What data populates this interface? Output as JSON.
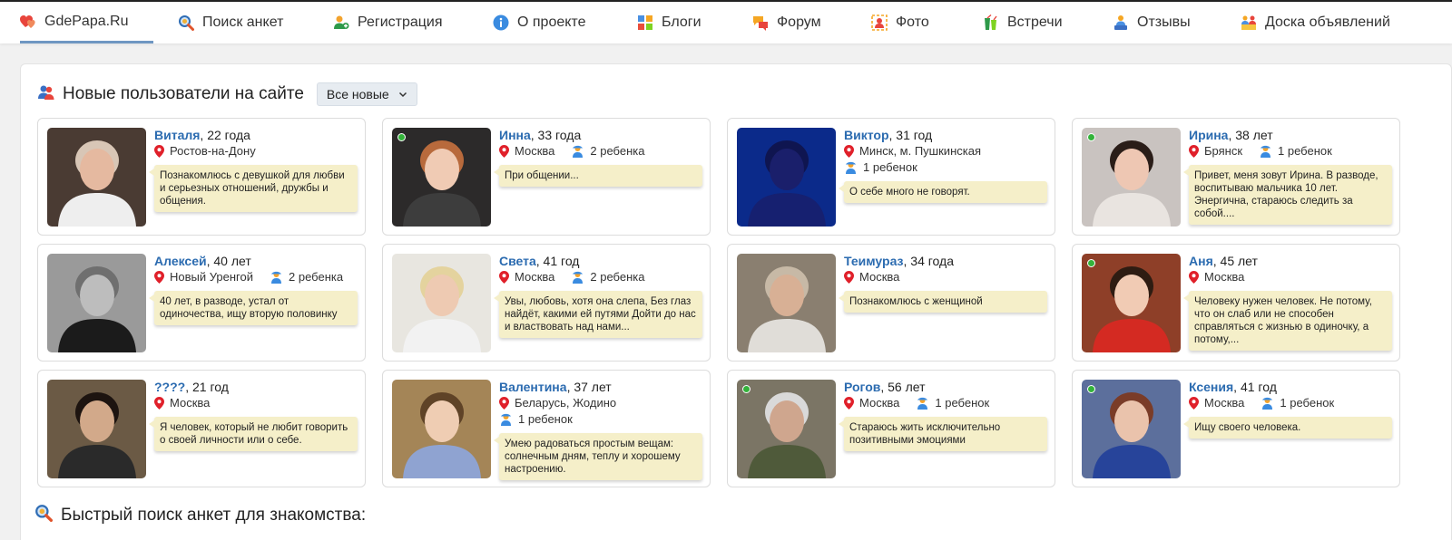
{
  "nav": {
    "logo": "GdePapa.Ru",
    "items": [
      "Поиск анкет",
      "Регистрация",
      "О проекте",
      "Блоги",
      "Форум",
      "Фото",
      "Встречи",
      "Отзывы",
      "Доска объявлений"
    ]
  },
  "new_users": {
    "title": "Новые пользователи на сайте",
    "filter": "Все новые"
  },
  "users": [
    {
      "name": "Виталя",
      "age": ", 22 года",
      "city": "Ростов-на-Дону",
      "kids": "",
      "about": "Познакомлюсь с девушкой для любви и серьезных отношений, дружбы и общения.",
      "online": false
    },
    {
      "name": "Инна",
      "age": ", 33 года",
      "city": "Москва",
      "kids": "2 ребенка",
      "about": "При общении...",
      "online": true
    },
    {
      "name": "Виктор",
      "age": ", 31 год",
      "city": "Минск, м. Пушкинская",
      "kids": "1 ребенок",
      "about": "О себе много не говорят.",
      "online": false
    },
    {
      "name": "Ирина",
      "age": ", 38 лет",
      "city": "Брянск",
      "kids": "1 ребенок",
      "about": "Привет, меня зовут Ирина. В разводе, воспитываю мальчика 10 лет. Энергична, стараюсь следить за собой....",
      "online": true
    },
    {
      "name": "Алексей",
      "age": ", 40 лет",
      "city": "Новый Уренгой",
      "kids": "2 ребенка",
      "about": "40 лет, в разводе, устал от одиночества, ищу вторую половинку",
      "online": false
    },
    {
      "name": "Света",
      "age": ", 41 год",
      "city": "Москва",
      "kids": "2 ребенка",
      "about": "Увы, любовь, хотя она слепа, Без глаз найдёт, какими ей путями Дойти до нас и властвовать над нами...",
      "online": false
    },
    {
      "name": "Теимураз",
      "age": ", 34 года",
      "city": "Москва",
      "kids": "",
      "about": "Познакомлюсь с женщиной",
      "online": false
    },
    {
      "name": "Аня",
      "age": ", 45 лет",
      "city": "Москва",
      "kids": "",
      "about": "Человеку нужен человек. Не потому, что он слаб или не способен справляться с жизнью в одиночку, а потому,...",
      "online": true
    },
    {
      "name": "????",
      "age": ", 21 год",
      "city": "Москва",
      "kids": "",
      "about": "Я человек, который не любит говорить о своей личности или о себе.",
      "online": false
    },
    {
      "name": "Валентина",
      "age": ", 37 лет",
      "city": "Беларусь, Жодино",
      "kids": "1 ребенок",
      "about": "Умею радоваться простым вещам: солнечным дням, теплу и хорошему настроению.",
      "online": false
    },
    {
      "name": "Рогов",
      "age": ", 56 лет",
      "city": "Москва",
      "kids": "1 ребенок",
      "about": "Стараюсь жить исключительно позитивными эмоциями",
      "online": true
    },
    {
      "name": "Ксения",
      "age": ", 41 год",
      "city": "Москва",
      "kids": "1 ребенок",
      "about": "Ищу своего человека.",
      "online": true
    }
  ],
  "quick_search": {
    "title": "Быстрый поиск анкет для знакомства:"
  },
  "colors": {
    "accent": "#2b6bb0",
    "bubble": "#f5efc9",
    "online": "#33b33a",
    "pin": "#e0202a"
  }
}
